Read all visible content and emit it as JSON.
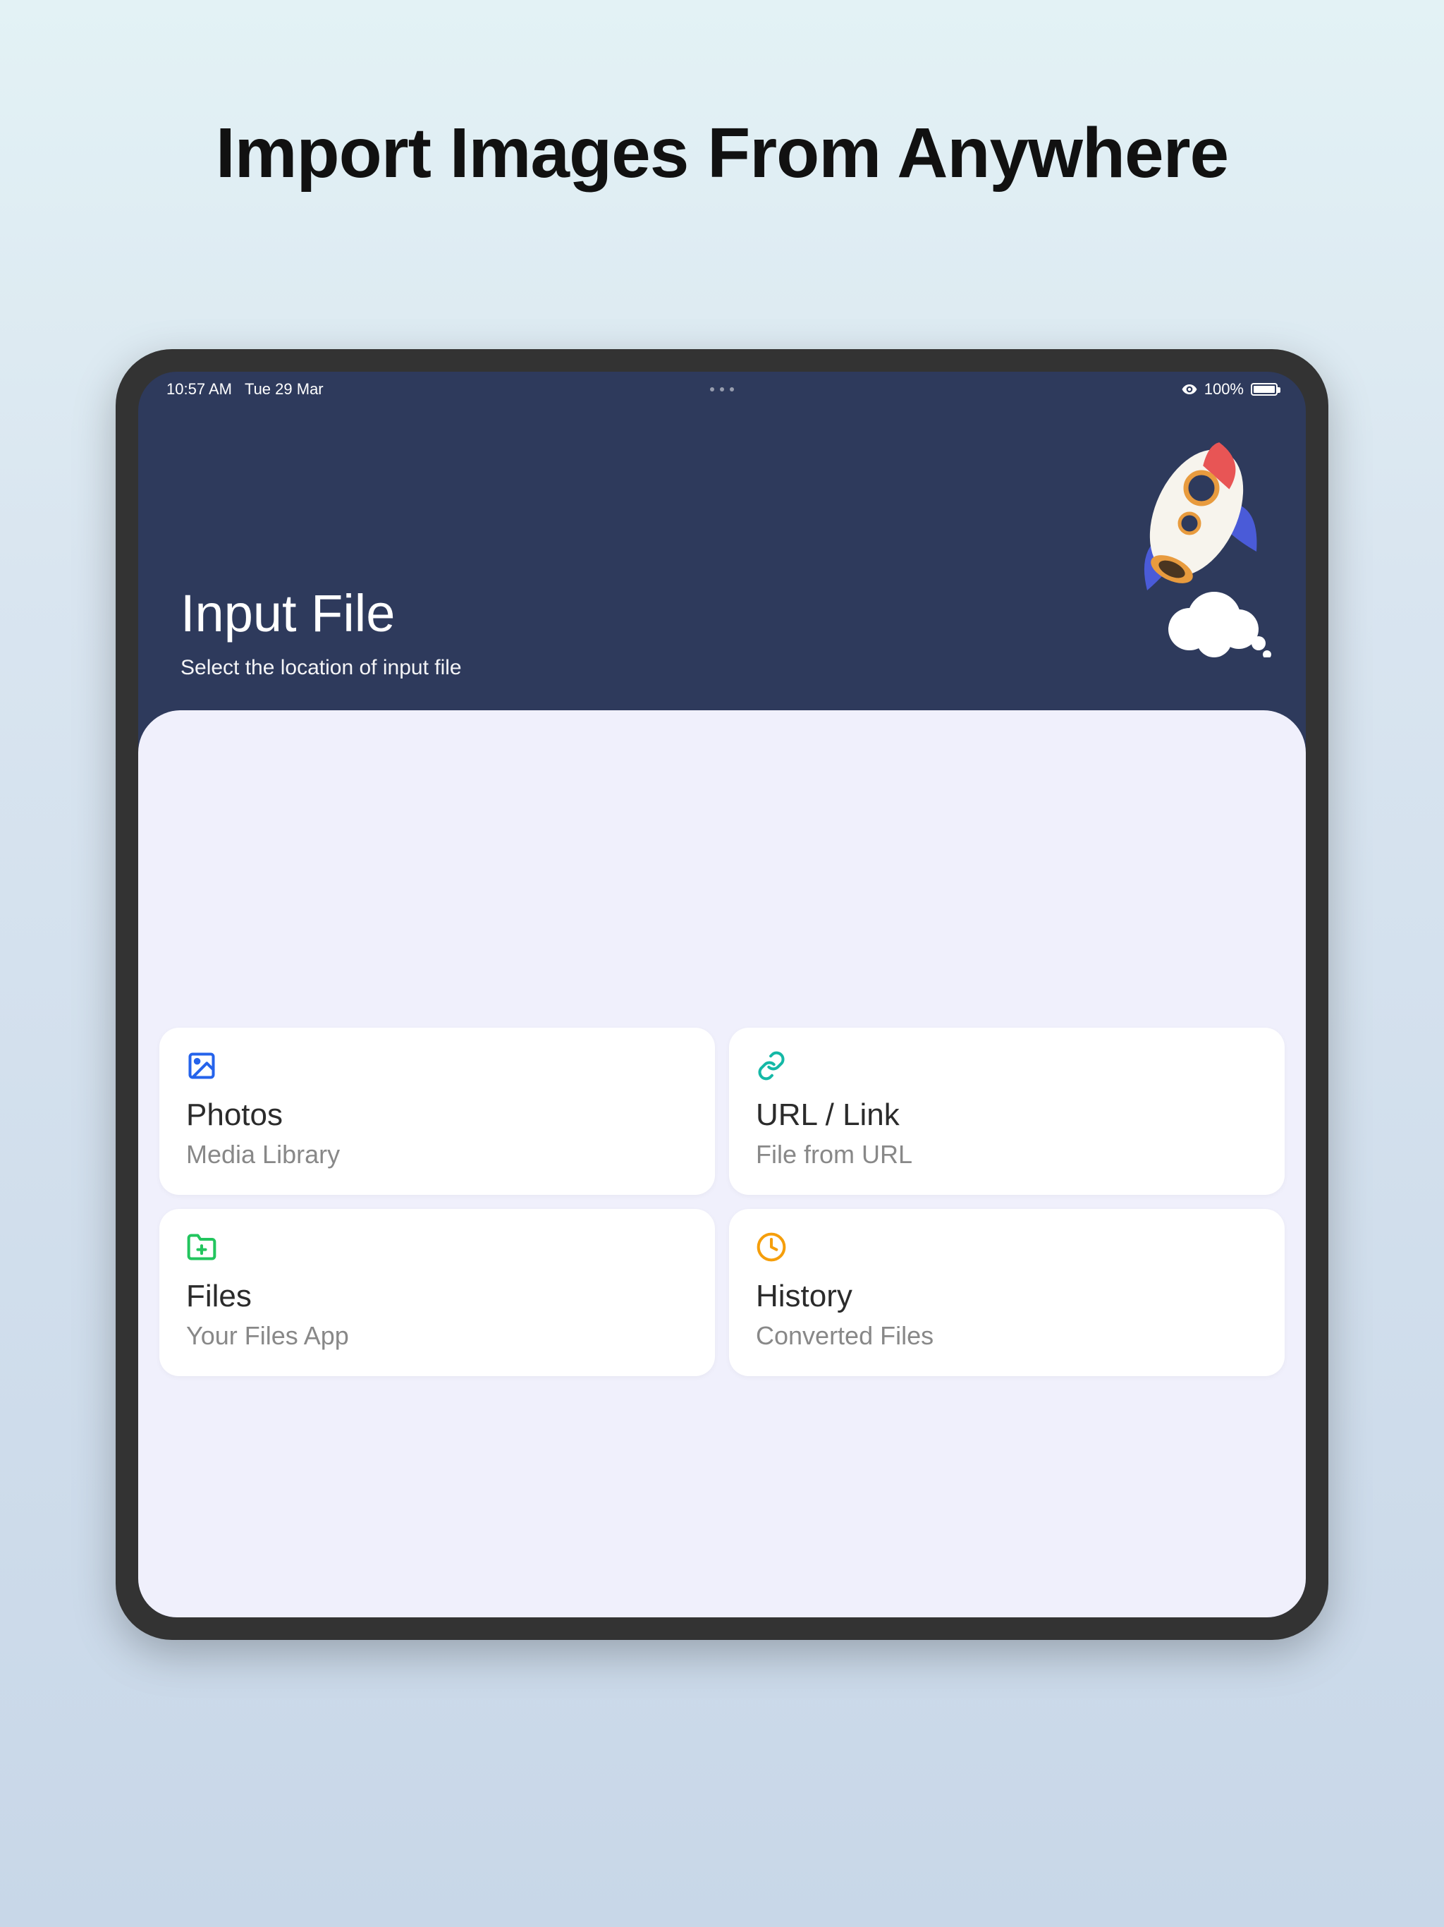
{
  "marketing": {
    "headline": "Import Images From Anywhere"
  },
  "statusbar": {
    "time": "10:57 AM",
    "date": "Tue 29 Mar",
    "battery_pct": "100%"
  },
  "header": {
    "title": "Input File",
    "subtitle": "Select the location of input file"
  },
  "options": [
    {
      "icon": "photo-icon",
      "icon_color": "#2563eb",
      "title": "Photos",
      "subtitle": "Media Library"
    },
    {
      "icon": "link-icon",
      "icon_color": "#14b8a6",
      "title": "URL / Link",
      "subtitle": "File from URL"
    },
    {
      "icon": "folder-plus-icon",
      "icon_color": "#22c55e",
      "title": "Files",
      "subtitle": "Your Files App"
    },
    {
      "icon": "clock-icon",
      "icon_color": "#f59e0b",
      "title": "History",
      "subtitle": "Converted Files"
    }
  ]
}
